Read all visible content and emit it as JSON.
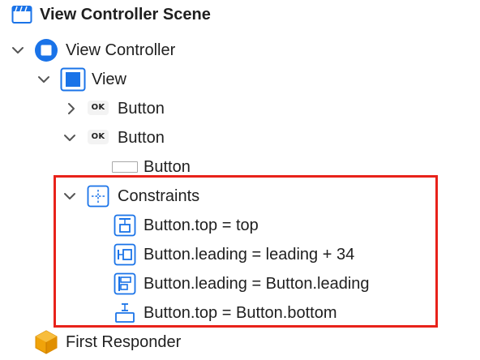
{
  "outline": {
    "scene": {
      "label": "View Controller Scene",
      "icon": "storyboard-scene-icon"
    },
    "view_controller": {
      "label": "View Controller",
      "icon": "view-controller-icon",
      "expanded": true
    },
    "view": {
      "label": "View",
      "icon": "view-icon",
      "expanded": true
    },
    "button_1": {
      "label": "Button",
      "badge": "OK",
      "expanded": false
    },
    "button_2": {
      "label": "Button",
      "badge": "OK",
      "expanded": true
    },
    "button_2_child": {
      "label": "Button",
      "icon": "button-shape-icon"
    },
    "constraints": {
      "label": "Constraints",
      "icon": "constraints-icon",
      "expanded": true,
      "items": [
        {
          "label": "Button.top = top",
          "icon": "top-space-constraint-icon"
        },
        {
          "label": "Button.leading = leading + 34",
          "icon": "leading-space-constraint-icon"
        },
        {
          "label": "Button.leading = Button.leading",
          "icon": "leading-edges-constraint-icon"
        },
        {
          "label": "Button.top = Button.bottom",
          "icon": "vertical-spacing-constraint-icon"
        }
      ]
    },
    "first_responder": {
      "label": "First Responder",
      "icon": "first-responder-icon"
    }
  },
  "colors": {
    "accent": "#1a73e8",
    "highlight": "#e8221a",
    "first_responder": "#f0a30a"
  }
}
